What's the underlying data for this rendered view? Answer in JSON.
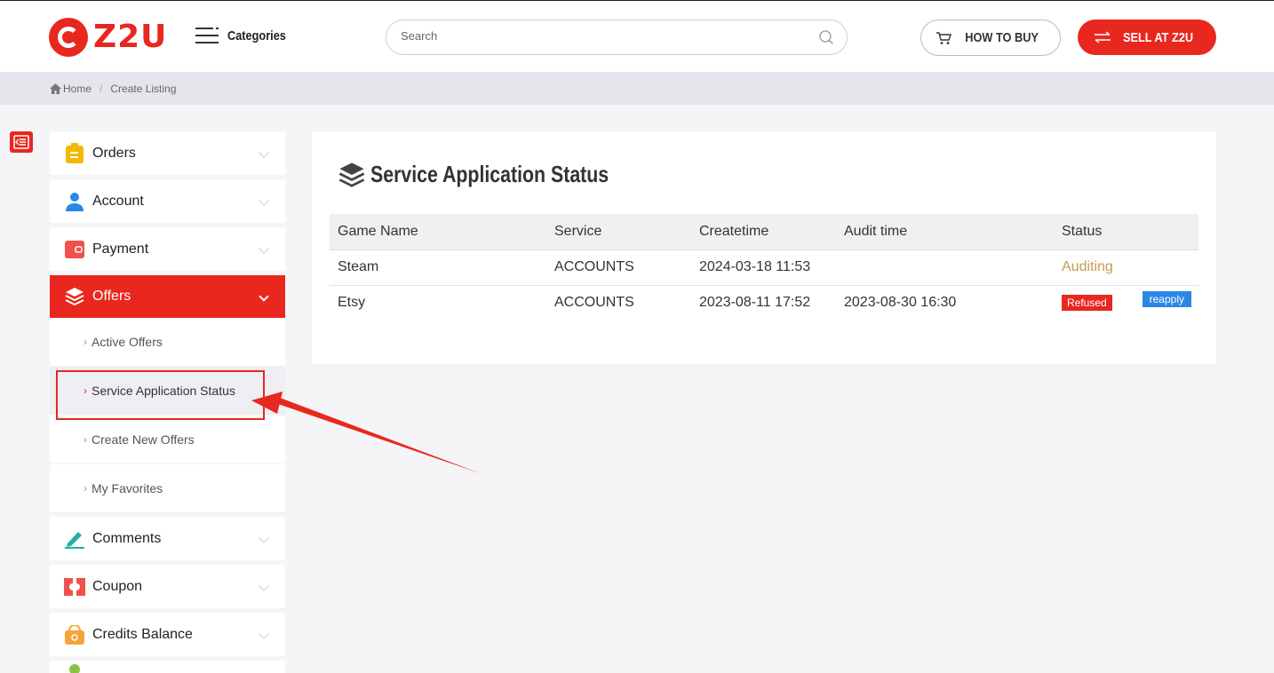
{
  "header": {
    "logo_text": "Z2U",
    "categories_label": "Categories",
    "search_placeholder": "Search",
    "how_to_buy_label": "HOW TO BUY",
    "sell_label": "SELL AT Z2U"
  },
  "breadcrumb": {
    "home": "Home",
    "current": "Create Listing"
  },
  "sidebar": {
    "orders": "Orders",
    "account": "Account",
    "payment": "Payment",
    "offers": "Offers",
    "offers_sub": {
      "active_offers": "Active Offers",
      "service_application_status": "Service Application Status",
      "create_new_offers": "Create New Offers",
      "my_favorites": "My Favorites"
    },
    "comments": "Comments",
    "coupon": "Coupon",
    "credits_balance": "Credits Balance"
  },
  "main": {
    "title": "Service Application Status",
    "columns": {
      "game_name": "Game Name",
      "service": "Service",
      "createtime": "Createtime",
      "audit_time": "Audit time",
      "status": "Status"
    },
    "rows": [
      {
        "game_name": "Steam",
        "service": "ACCOUNTS",
        "createtime": "2024-03-18 11:53",
        "audit_time": "",
        "status": "Auditing"
      },
      {
        "game_name": "Etsy",
        "service": "ACCOUNTS",
        "createtime": "2023-08-11 17:52",
        "audit_time": "2023-08-30 16:30",
        "status": "Refused",
        "action": "reapply"
      }
    ]
  },
  "colors": {
    "brand_red": "#e8271f",
    "auditing": "#c89a4d",
    "reapply_blue": "#2b87e6"
  }
}
